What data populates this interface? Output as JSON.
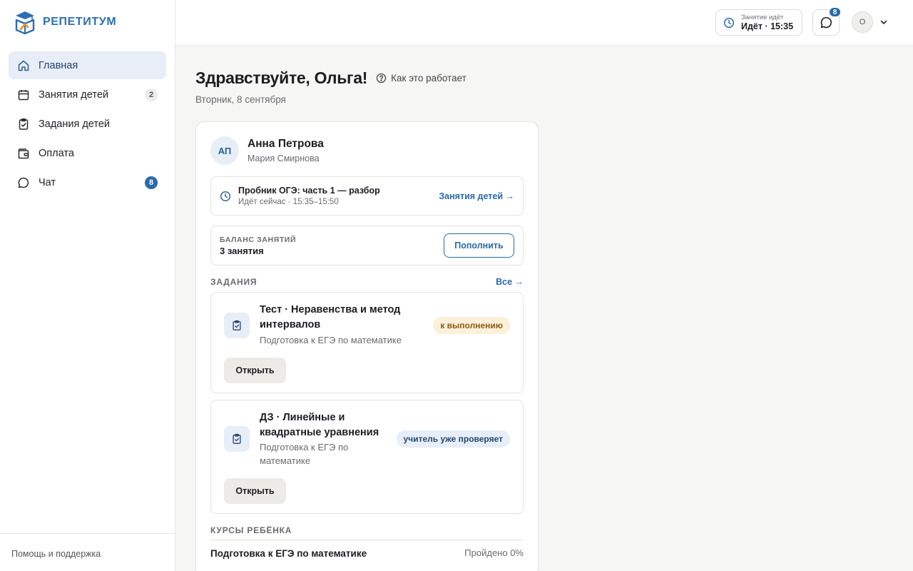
{
  "app": {
    "name": "РЕПЕТИТУМ"
  },
  "sidebar": {
    "items": [
      {
        "label": "Главная",
        "icon": "home-icon",
        "active": true,
        "count": ""
      },
      {
        "label": "Занятия детей",
        "icon": "calendar-icon",
        "active": false,
        "count": "2"
      },
      {
        "label": "Задания детей",
        "icon": "clipboard-check-icon",
        "active": false,
        "count": ""
      },
      {
        "label": "Оплата",
        "icon": "wallet-icon",
        "active": false,
        "count": ""
      },
      {
        "label": "Чат",
        "icon": "chat-icon",
        "active": false,
        "count": "8"
      }
    ],
    "footer": "Помощь и поддержка"
  },
  "header": {
    "lesson_label": "Занятие идёт",
    "lesson_value": "Идёт · 15:35",
    "chat_badge": "8",
    "avatar_initial": "О"
  },
  "main": {
    "greeting": "Здравствуйте, Ольга!",
    "how_it_works": "Как это работает",
    "date": "Вторник, 8 сентября",
    "child": {
      "initials": "АП",
      "name": "Анна Петрова",
      "teacher": "Мария Смирнова"
    },
    "live_lesson": {
      "title": "Пробник ОГЭ: часть 1 — разбор",
      "subtitle": "Идёт сейчас · 15:35–15:50",
      "link": "Занятия детей →"
    },
    "balance": {
      "label": "БАЛАНС ЗАНЯТИЙ",
      "value": "3 занятия",
      "button": "Пополнить"
    },
    "tasks_section": {
      "title": "ЗАДАНИЯ",
      "link": "Все →"
    },
    "tasks": [
      {
        "title_line1": "Тест · Неравенства и метод",
        "title_line2": "интервалов",
        "subtitle_line1": "Подготовка к ЕГЭ по математике",
        "subtitle_line2": "",
        "status": "к выполнению",
        "button": "Открыть"
      },
      {
        "title_line1": "ДЗ · Линейные и",
        "title_line2": "квадратные уравнения",
        "subtitle_line1": "Подготовка к ЕГЭ по",
        "subtitle_line2": "математике",
        "status": "учитель уже проверяет",
        "button": "Открыть"
      }
    ],
    "courses_section": {
      "title": "КУРСЫ РЕБЁНКА"
    },
    "courses": [
      {
        "name": "Подготовка к ЕГЭ по математике",
        "progress": "Пройдено 0%"
      }
    ]
  },
  "colors": {
    "accent": "#2b6aa8",
    "warn_bg": "#fdf0d9",
    "info_bg": "#e7eef7"
  }
}
